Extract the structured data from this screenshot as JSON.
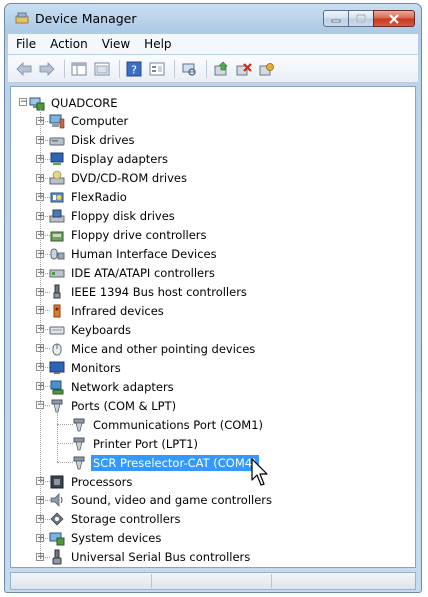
{
  "window": {
    "title": "Device Manager"
  },
  "menu": [
    "File",
    "Action",
    "View",
    "Help"
  ],
  "toolbar": {
    "buttons": [
      "back-icon",
      "forward-icon",
      "properties-pane-icon",
      "show-hidden-icon",
      "help-icon",
      "properties-icon",
      "scan-hardware-icon",
      "update-driver-icon",
      "uninstall-icon",
      "disable-icon"
    ]
  },
  "tree": {
    "root": "QUADCORE",
    "categories": [
      {
        "label": "Computer",
        "icon": "computer-icon"
      },
      {
        "label": "Disk drives",
        "icon": "disk-drive-icon"
      },
      {
        "label": "Display adapters",
        "icon": "display-adapter-icon"
      },
      {
        "label": "DVD/CD-ROM drives",
        "icon": "dvd-drive-icon"
      },
      {
        "label": "FlexRadio",
        "icon": "flexradio-icon"
      },
      {
        "label": "Floppy disk drives",
        "icon": "floppy-drive-icon"
      },
      {
        "label": "Floppy drive controllers",
        "icon": "floppy-controller-icon"
      },
      {
        "label": "Human Interface Devices",
        "icon": "hid-icon"
      },
      {
        "label": "IDE ATA/ATAPI controllers",
        "icon": "ide-controller-icon"
      },
      {
        "label": "IEEE 1394 Bus host controllers",
        "icon": "firewire-icon"
      },
      {
        "label": "Infrared devices",
        "icon": "infrared-icon"
      },
      {
        "label": "Keyboards",
        "icon": "keyboard-icon"
      },
      {
        "label": "Mice and other pointing devices",
        "icon": "mouse-icon"
      },
      {
        "label": "Monitors",
        "icon": "monitor-icon"
      },
      {
        "label": "Network adapters",
        "icon": "network-adapter-icon"
      },
      {
        "label": "Ports (COM & LPT)",
        "icon": "port-icon",
        "expanded": true,
        "children": [
          {
            "label": "Communications Port (COM1)",
            "icon": "port-icon"
          },
          {
            "label": "Printer Port (LPT1)",
            "icon": "port-icon"
          },
          {
            "label": "SCR Preselector-CAT (COM4)",
            "icon": "port-icon",
            "selected": true
          }
        ]
      },
      {
        "label": "Processors",
        "icon": "processor-icon"
      },
      {
        "label": "Sound, video and game controllers",
        "icon": "sound-icon"
      },
      {
        "label": "Storage controllers",
        "icon": "storage-controller-icon"
      },
      {
        "label": "System devices",
        "icon": "system-device-icon"
      },
      {
        "label": "Universal Serial Bus controllers",
        "icon": "usb-icon"
      }
    ]
  },
  "colors": {
    "selection": "#3399ff",
    "frame": "#aecbe6"
  }
}
